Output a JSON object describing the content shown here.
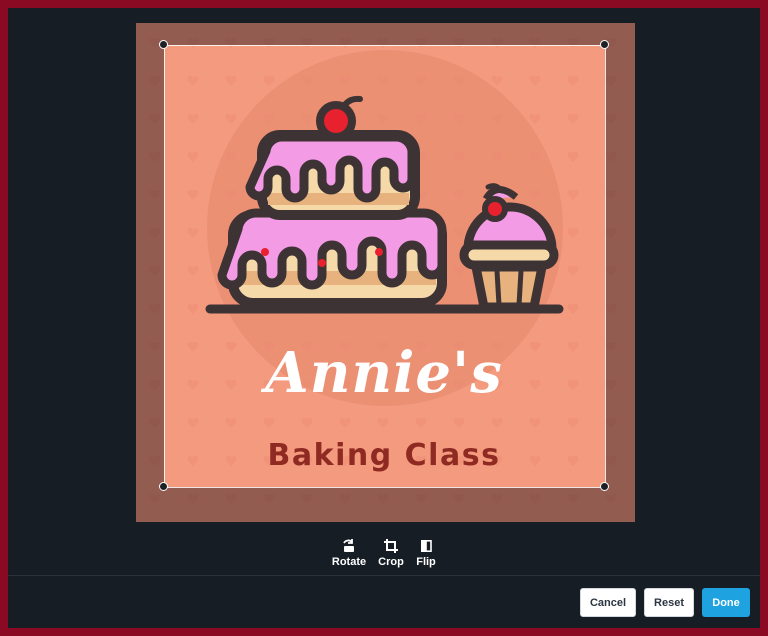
{
  "image": {
    "brand_title": "Annie's",
    "brand_subtitle": "Baking Class"
  },
  "toolbar": {
    "rotate_label": "Rotate",
    "crop_label": "Crop",
    "flip_label": "Flip"
  },
  "footer": {
    "cancel_label": "Cancel",
    "reset_label": "Reset",
    "done_label": "Done"
  },
  "colors": {
    "outer_border": "#8a0a24",
    "panel_bg": "#161d24",
    "image_bg": "#f49a7f",
    "accent": "#1fa3e0",
    "frosting": "#f49be6",
    "cherry": "#e8212e",
    "outline": "#3d3234",
    "sponge": "#f5d9a8",
    "subtitle": "#8e2a22"
  }
}
